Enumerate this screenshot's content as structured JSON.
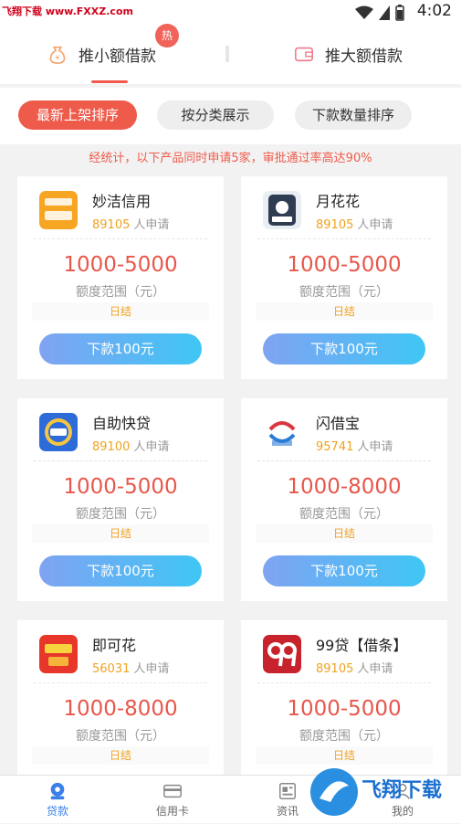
{
  "status_bar": {
    "watermark": "飞翔下载 www.FXXZ.com",
    "time": "4:02"
  },
  "top_tabs": [
    {
      "label": "推小额借款",
      "badge": "热",
      "active": true
    },
    {
      "label": "推大额借款",
      "active": false
    }
  ],
  "filters": [
    {
      "label": "最新上架排序",
      "active": true
    },
    {
      "label": "按分类展示",
      "active": false
    },
    {
      "label": "下款数量排序",
      "active": false
    }
  ],
  "notice": "经统计，以下产品同时申请5家，审批通过率高达90%",
  "applied_suffix": "人申请",
  "amount_label": "额度范围（元）",
  "settle_label": "日结",
  "button_label": "下款100元",
  "products": [
    {
      "name": "妙洁信用",
      "count": "89105",
      "amount": "1000-5000"
    },
    {
      "name": "月花花",
      "count": "89105",
      "amount": "1000-5000"
    },
    {
      "name": "自助快贷",
      "count": "89100",
      "amount": "1000-5000"
    },
    {
      "name": "闪借宝",
      "count": "95741",
      "amount": "1000-8000"
    },
    {
      "name": "即可花",
      "count": "56031",
      "amount": "1000-8000"
    },
    {
      "name": "99贷【借条】",
      "count": "89105",
      "amount": "1000-5000"
    }
  ],
  "bottom_nav": [
    {
      "label": "贷款",
      "active": true
    },
    {
      "label": "信用卡"
    },
    {
      "label": "资讯"
    },
    {
      "label": "我的"
    }
  ],
  "brand_watermark": "飞翔下载",
  "colors": {
    "accent": "#ef5b4b",
    "amount": "#e8574b",
    "count": "#f0a21f",
    "button_start": "#7fa3f2",
    "button_end": "#3fc6f5",
    "nav_active": "#3a80e8"
  }
}
